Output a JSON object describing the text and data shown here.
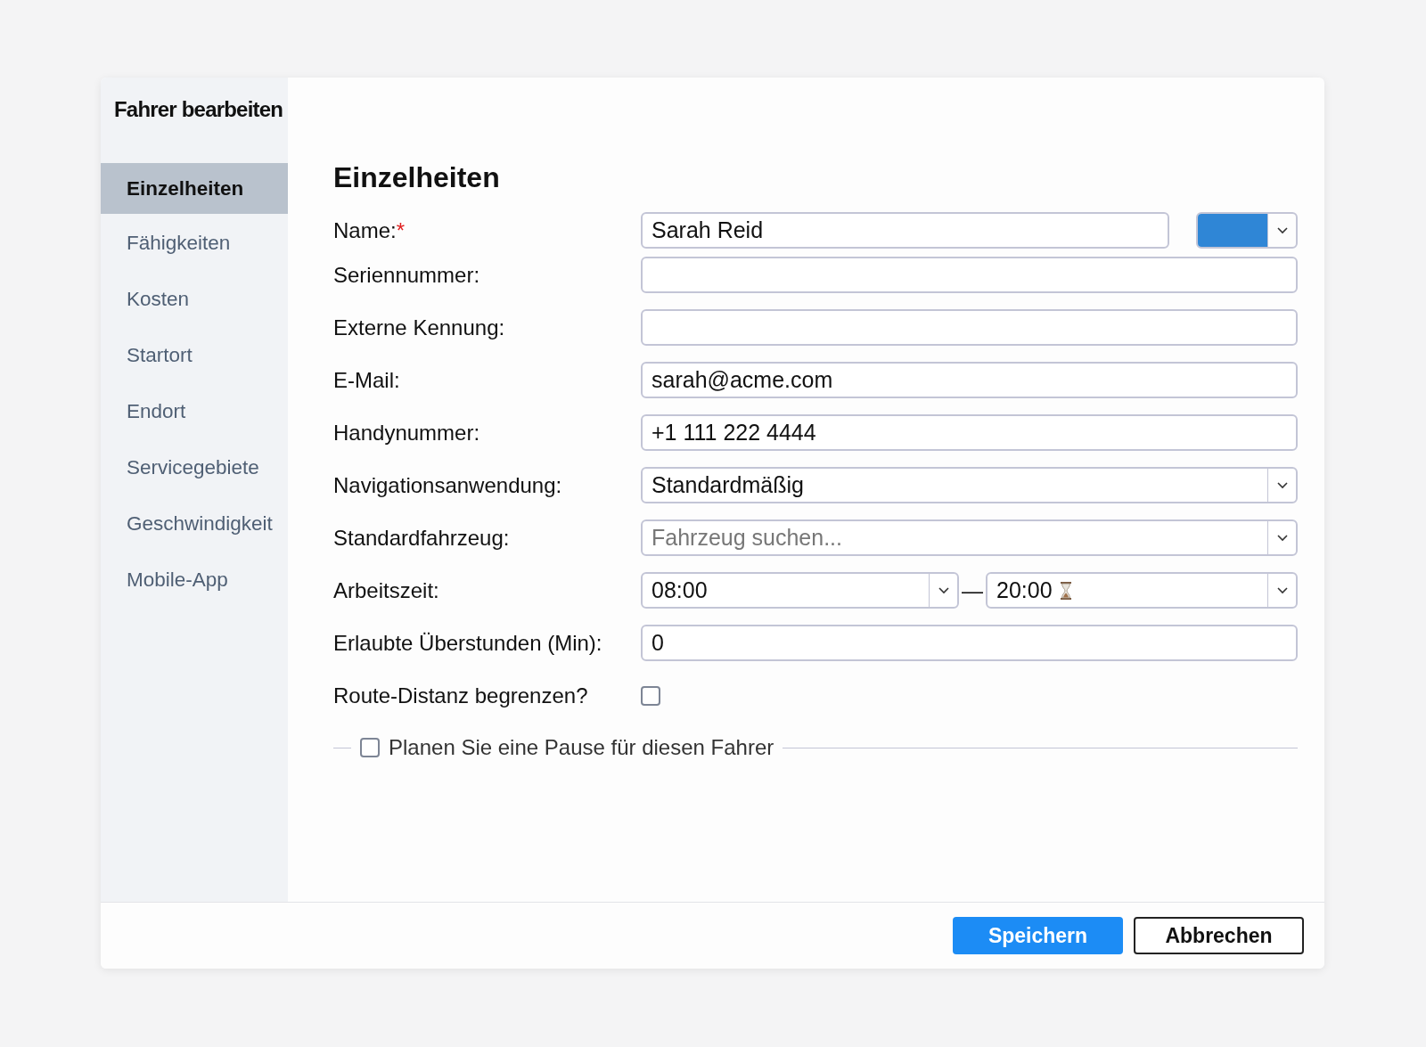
{
  "dialog": {
    "title": "Fahrer bearbeiten"
  },
  "sidebar": {
    "items": [
      {
        "label": "Einzelheiten",
        "selected": true
      },
      {
        "label": "Fähigkeiten",
        "selected": false
      },
      {
        "label": "Kosten",
        "selected": false
      },
      {
        "label": "Startort",
        "selected": false
      },
      {
        "label": "Endort",
        "selected": false
      },
      {
        "label": "Servicegebiete",
        "selected": false
      },
      {
        "label": "Geschwindigkeit",
        "selected": false
      },
      {
        "label": "Mobile-App",
        "selected": false
      }
    ]
  },
  "section": {
    "title": "Einzelheiten"
  },
  "fields": [
    {
      "kind": "text_color",
      "label": "Name:",
      "required_mark": "*",
      "value": "Sarah Reid",
      "color": "#2f86d6"
    },
    {
      "kind": "text",
      "label": "Seriennummer:"
    },
    {
      "kind": "text",
      "label": "Externe Kennung:"
    },
    {
      "kind": "text",
      "label": "E-Mail:",
      "value": "sarah@acme.com"
    },
    {
      "kind": "text",
      "label": "Handynummer:",
      "value": "+1 111 222 4444"
    },
    {
      "kind": "select",
      "label": "Navigationsanwendung:",
      "value": "Standardmäßig"
    },
    {
      "kind": "select",
      "label": "Standardfahrzeug:",
      "placeholder": "Fahrzeug suchen..."
    },
    {
      "kind": "time_range",
      "label": "Arbeitszeit:",
      "from": "08:00",
      "separator": "—",
      "to": "20:00"
    },
    {
      "kind": "text",
      "label": "Erlaubte Überstunden (Min):",
      "value": "0"
    },
    {
      "kind": "checkbox",
      "label": "Route-Distanz begrenzen?",
      "checked": false
    }
  ],
  "break_section": {
    "label": "Planen Sie eine Pause für diesen Fahrer",
    "checked": false
  },
  "buttons": [
    {
      "label": "Speichern",
      "kind": "primary"
    },
    {
      "label": "Abbrechen",
      "kind": "secondary"
    }
  ]
}
